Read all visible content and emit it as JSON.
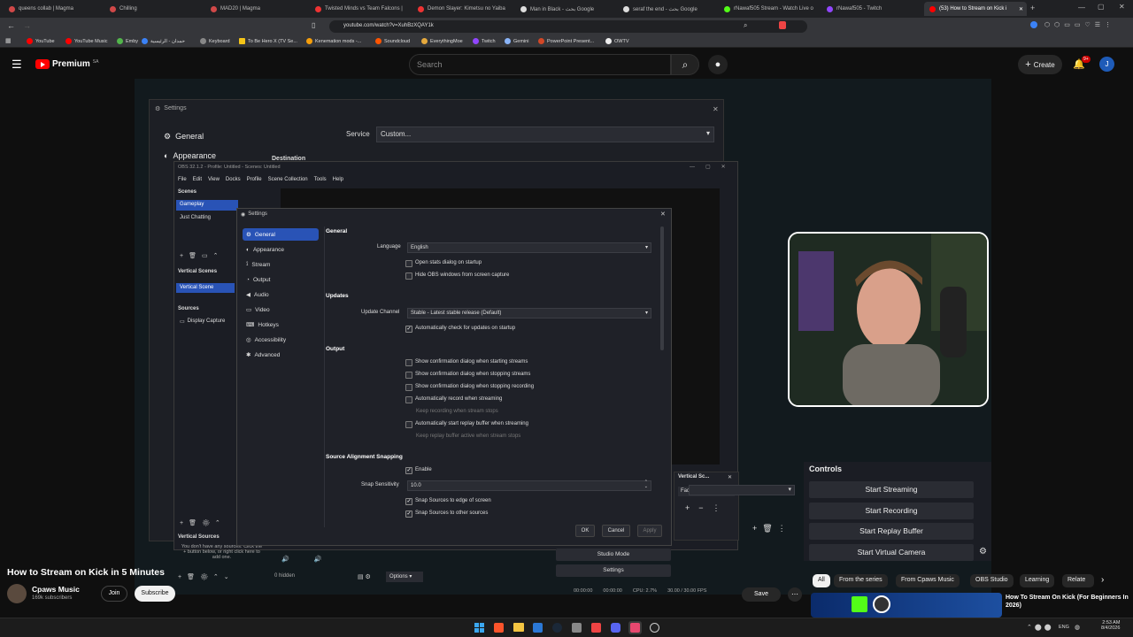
{
  "browser": {
    "tabs": [
      {
        "label": "queens collab | Magma",
        "color": "#d04848"
      },
      {
        "label": "Chilling",
        "color": "#d04848"
      },
      {
        "label": "MAD20 | Magma",
        "color": "#d04848"
      },
      {
        "label": "Twisted Minds vs Team Falcons |",
        "color": "#e33"
      },
      {
        "label": "Demon Slayer: Kimetsu no Yaiba",
        "color": "#e33"
      },
      {
        "label": "Man in Black - بحث Google",
        "color": "#ddd"
      },
      {
        "label": "seraf the end - بحث Google",
        "color": "#ddd"
      },
      {
        "label": "rNawaf505 Stream - Watch Live o",
        "color": "#53fc18"
      },
      {
        "label": "rNawaf505 - Twitch",
        "color": "#9146ff"
      },
      {
        "label": "(53) How to Stream on Kick i",
        "color": "#ff0000"
      }
    ],
    "url": "youtube.com/watch?v=XuhBzXQAY1k",
    "bookmarks": [
      "YouTube",
      "YouTube Music",
      "Emby",
      "حمدان - الرئيسية",
      "Keyboard",
      "To Be Hero X (TV Se...",
      "Kenemation mods -...",
      "Soundcloud",
      "EverythingMoe",
      "Twitch",
      "Gemini",
      "PowerPoint Present...",
      "OWTV"
    ]
  },
  "youtube": {
    "logo": "Premium",
    "region": "SA",
    "search_placeholder": "Search",
    "create_label": "Create",
    "notif_count": "9+",
    "avatar_letter": "J"
  },
  "obs_back": {
    "title": "Settings",
    "items": [
      "General",
      "Appearance"
    ],
    "service_label": "Service",
    "service_value": "Custom...",
    "destination": "Destination"
  },
  "obs": {
    "title": "OBS 32.1.2 - Profile: Untitled - Scenes: Untitled",
    "menu": [
      "File",
      "Edit",
      "View",
      "Docks",
      "Profile",
      "Scene Collection",
      "Tools",
      "Help"
    ],
    "scenes_header": "Scenes",
    "scenes": [
      "Gameplay",
      "Just Chatting"
    ],
    "vertical_scenes_header": "Vertical Scenes",
    "vertical_scene": "Vertical Scene",
    "sources_header": "Sources",
    "source": "Display Capture",
    "vertical_sources_header": "Vertical Sources",
    "no_sources": "You don't have any sources. Click the + button below, or right click here to add one.",
    "hidden": "0 hidden",
    "options": "Options",
    "studio_mode": "Studio Mode",
    "settings_btn": "Settings",
    "vertical_sc": "Vertical Sc...",
    "fade": "Fade",
    "status_time1": "00:00:00",
    "status_time2": "00:00:00",
    "cpu": "CPU: 2.7%",
    "fps": "30.00 / 30.00 FPS"
  },
  "settings": {
    "title": "Settings",
    "sidebar": [
      "General",
      "Appearance",
      "Stream",
      "Output",
      "Audio",
      "Video",
      "Hotkeys",
      "Accessibility",
      "Advanced"
    ],
    "general_header": "General",
    "language_label": "Language",
    "language_value": "English",
    "general_opts": [
      {
        "label": "Open stats dialog on startup",
        "checked": false
      },
      {
        "label": "Hide OBS windows from screen capture",
        "checked": false
      }
    ],
    "updates_header": "Updates",
    "update_channel_label": "Update Channel",
    "update_channel_value": "Stable - Latest stable release (Default)",
    "auto_update": "Automatically check for updates on startup",
    "output_header": "Output",
    "output_opts": [
      {
        "label": "Show confirmation dialog when starting streams",
        "checked": false,
        "dim": false
      },
      {
        "label": "Show confirmation dialog when stopping streams",
        "checked": false,
        "dim": false
      },
      {
        "label": "Show confirmation dialog when stopping recording",
        "checked": false,
        "dim": false
      },
      {
        "label": "Automatically record when streaming",
        "checked": false,
        "dim": false
      },
      {
        "label": "Keep recording when stream stops",
        "checked": false,
        "dim": true
      },
      {
        "label": "Automatically start replay buffer when streaming",
        "checked": false,
        "dim": false
      },
      {
        "label": "Keep replay buffer active when stream stops",
        "checked": false,
        "dim": true
      }
    ],
    "snap_header": "Source Alignment Snapping",
    "snap_enable": "Enable",
    "snap_sensitivity_label": "Snap Sensitivity",
    "snap_sensitivity_value": "10.0",
    "snap_edge": "Snap Sources to edge of screen",
    "snap_other": "Snap Sources to other sources",
    "ok": "OK",
    "cancel": "Cancel",
    "apply": "Apply"
  },
  "controls": {
    "header": "Controls",
    "buttons": [
      "Start Streaming",
      "Start Recording",
      "Start Replay Buffer",
      "Start Virtual Camera"
    ]
  },
  "video": {
    "title": "How to Stream on Kick in 5 Minutes",
    "channel": "Cpaws Music",
    "subscribers": "169k subscribers",
    "join": "Join",
    "subscribe": "Subscribe",
    "save": "Save"
  },
  "chips": [
    "All",
    "From the series",
    "From Cpaws Music",
    "OBS Studio",
    "Learning",
    "Relate"
  ],
  "recommendation": {
    "title": "How To Stream On Kick (For Beginners In 2026)"
  },
  "tray": {
    "lang": "ENG",
    "time": "2:53 AM",
    "date": "8/4/2026"
  }
}
